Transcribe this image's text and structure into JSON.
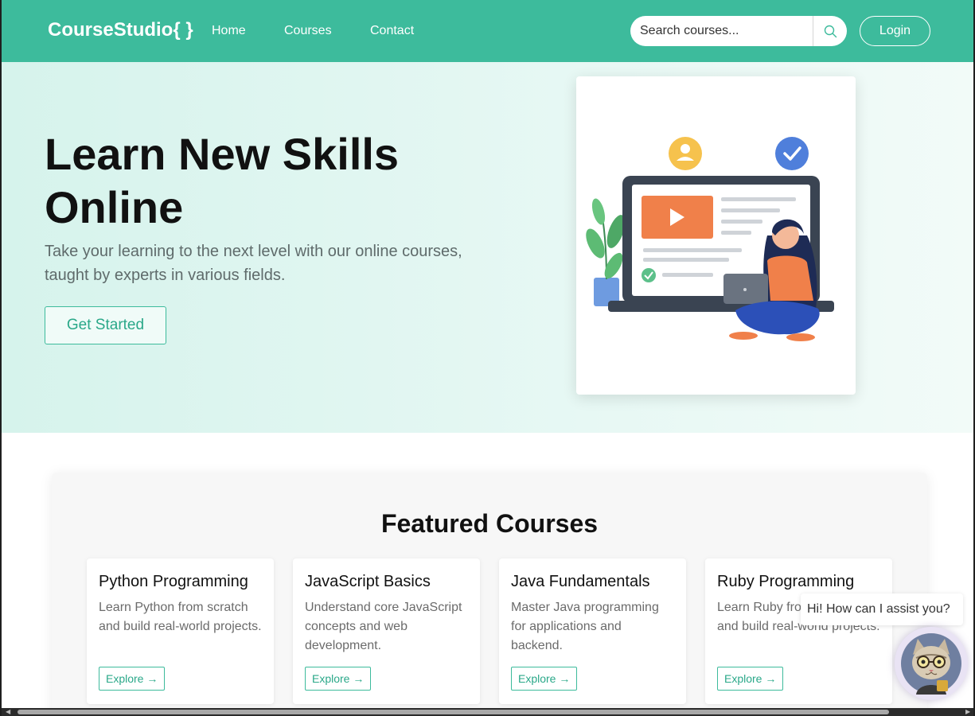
{
  "navbar": {
    "brand": "CourseStudio{ }",
    "links": [
      "Home",
      "Courses",
      "Contact"
    ],
    "search_placeholder": "Search courses...",
    "search_icon": "search-icon",
    "login_label": "Login"
  },
  "hero": {
    "title": "Learn New Skills Online",
    "subtitle": "Take your learning to the next level with our online courses, taught by experts in various fields.",
    "cta_label": "Get Started",
    "illustration": "woman-with-laptop-video-course-illustration"
  },
  "featured": {
    "title": "Featured Courses",
    "courses": [
      {
        "title": "Python Programming",
        "description": "Learn Python from scratch and build real-world projects.",
        "button": "Explore →"
      },
      {
        "title": "JavaScript Basics",
        "description": "Understand core JavaScript concepts and web development.",
        "button": "Explore →"
      },
      {
        "title": "Java Fundamentals",
        "description": "Master Java programming for applications and backend.",
        "button": "Explore →"
      },
      {
        "title": "Ruby Programming",
        "description": "Learn Ruby from scratch and build real-world projects.",
        "button": "Explore →"
      }
    ]
  },
  "chat": {
    "message": "Hi! How can I assist you?",
    "avatar": "cat-with-glasses-avatar"
  },
  "colors": {
    "brand": "#3dbb9c",
    "hero_bg": "#e0f6f0",
    "accent_text": "#2aa889"
  }
}
